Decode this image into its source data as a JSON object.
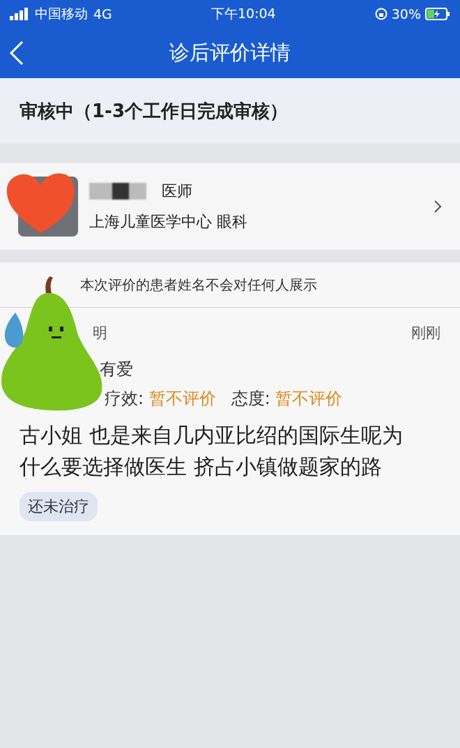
{
  "status_bar": {
    "carrier": "中国移动",
    "network": "4G",
    "time": "下午10:04",
    "battery": "30%"
  },
  "nav": {
    "title": "诊后评价详情"
  },
  "review_status": "审核中（1-3个工作日完成审核）",
  "doctor": {
    "title": "医师",
    "hospital": "上海儿童医学中心 眼科"
  },
  "notice": "本次评价的患者姓名不会对任何人展示",
  "review": {
    "user": "明",
    "time": "刚刚",
    "line2": "有爱",
    "ratings": [
      {
        "label": "疗效:",
        "value": "暂不评价"
      },
      {
        "label": "态度:",
        "value": "暂不评价"
      }
    ],
    "comment": "古小姐 也是来自几内亚比绍的国际生呢为什么要选择做医生 挤占小镇做题家的路",
    "tag": "还未治疗"
  }
}
